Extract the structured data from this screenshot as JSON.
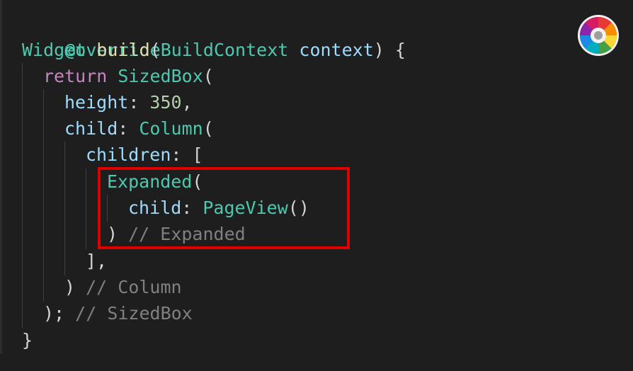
{
  "code": {
    "line1": {
      "annotation": "@override"
    },
    "line2": {
      "type": "Widget",
      "fn": "build",
      "open": "(",
      "param_type": "BuildContext",
      "param": "context",
      "close": ") {"
    },
    "line3": {
      "keyword": "return",
      "type": "SizedBox",
      "open": "("
    },
    "line4": {
      "prop": "height",
      "colon": ": ",
      "value": "350",
      "comma": ","
    },
    "line5": {
      "prop": "child",
      "colon": ": ",
      "type": "Column",
      "open": "("
    },
    "line6": {
      "prop": "children",
      "colon": ": ",
      "open": "["
    },
    "line7": {
      "type": "Expanded",
      "open": "("
    },
    "line8": {
      "prop": "child",
      "colon": ": ",
      "type": "PageView",
      "call": "()"
    },
    "line9": {
      "close": ")",
      "comment": " // Expanded"
    },
    "line10": {
      "close": "],",
      "comment": ""
    },
    "line11": {
      "close": ")",
      "comment": " // Column"
    },
    "line12": {
      "close": ");",
      "comment": " // SizedBox"
    },
    "line13": {
      "close": "}"
    }
  },
  "highlight": {
    "color": "#e00000"
  },
  "logo": {
    "icon": "color-wheel-icon"
  }
}
